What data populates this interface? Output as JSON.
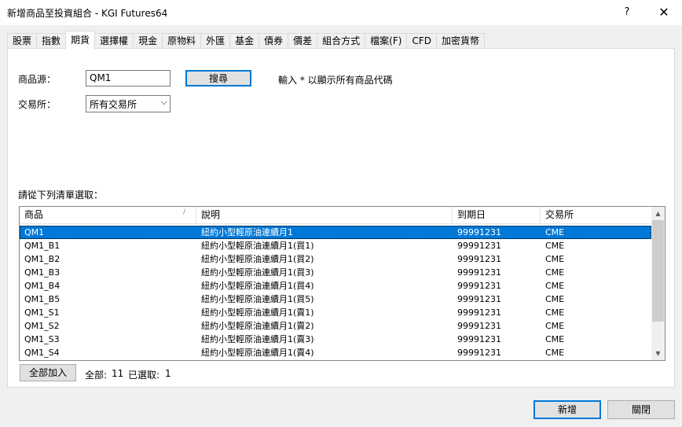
{
  "window": {
    "title": "新增商品至投資組合 - KGI Futures64",
    "help": "?",
    "close": "✕"
  },
  "tabs": [
    "股票",
    "指數",
    "期貨",
    "選擇權",
    "現金",
    "原物料",
    "外匯",
    "基金",
    "債券",
    "價差",
    "組合方式",
    "檔案(F)",
    "CFD",
    "加密貨幣"
  ],
  "active_tab": "期貨",
  "form": {
    "symbol_label": "商品源：",
    "symbol_value": "QM1",
    "search_label": "搜尋",
    "hint": "輸入 * 以顯示所有商品代碼",
    "exchange_label": "交易所：",
    "exchange_value": "所有交易所",
    "list_prompt": "請從下列清單選取："
  },
  "table": {
    "columns": [
      "商品",
      "說明",
      "到期日",
      "交易所"
    ],
    "rows": [
      [
        "QM1",
        "紐約小型輕原油連續月1",
        "99991231",
        "CME"
      ],
      [
        "QM1_B1",
        "紐約小型輕原油連續月1(買1)",
        "99991231",
        "CME"
      ],
      [
        "QM1_B2",
        "紐約小型輕原油連續月1(買2)",
        "99991231",
        "CME"
      ],
      [
        "QM1_B3",
        "紐約小型輕原油連續月1(買3)",
        "99991231",
        "CME"
      ],
      [
        "QM1_B4",
        "紐約小型輕原油連續月1(買4)",
        "99991231",
        "CME"
      ],
      [
        "QM1_B5",
        "紐約小型輕原油連續月1(買5)",
        "99991231",
        "CME"
      ],
      [
        "QM1_S1",
        "紐約小型輕原油連續月1(賣1)",
        "99991231",
        "CME"
      ],
      [
        "QM1_S2",
        "紐約小型輕原油連續月1(賣2)",
        "99991231",
        "CME"
      ],
      [
        "QM1_S3",
        "紐約小型輕原油連續月1(賣3)",
        "99991231",
        "CME"
      ],
      [
        "QM1_S4",
        "紐約小型輕原油連續月1(賣4)",
        "99991231",
        "CME"
      ]
    ],
    "selected_index": 0
  },
  "footer": {
    "add_all_label": "全部加入",
    "total_label": "全部:",
    "total_count": "11",
    "selected_label": "已選取:",
    "selected_count": "1",
    "add_label": "新增",
    "close_label": "關閉"
  },
  "colors": {
    "accent": "#0078d7",
    "selection": "#0078d7"
  }
}
